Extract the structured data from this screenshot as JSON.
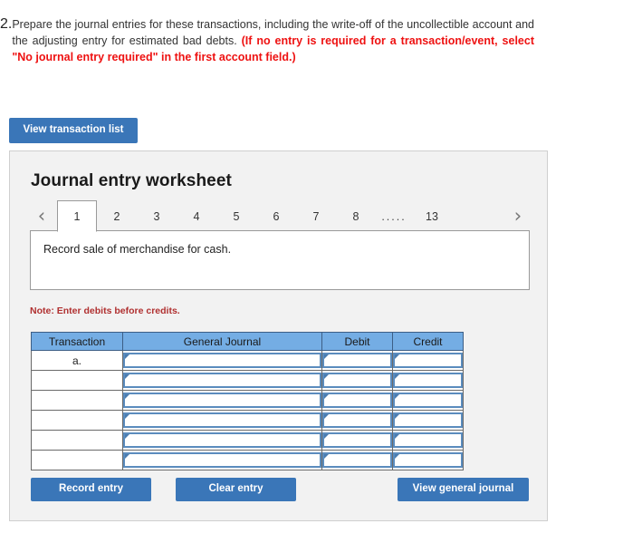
{
  "question": {
    "number": "2.",
    "text_plain_1": "Prepare the journal entries for these transactions, including the write-off of the uncollectible account and the adjusting entry for estimated bad debts. ",
    "text_red": "(If no entry is required for a transaction/event, select \"No journal entry required\" in the first account field.)"
  },
  "toolbar": {
    "view_transaction_list_label": "View transaction list"
  },
  "panel": {
    "title": "Journal entry worksheet",
    "note": "Note: Enter debits before credits.",
    "instruction": "Record sale of merchandise for cash."
  },
  "pager": {
    "prev_icon": "‹",
    "next_icon": "›",
    "items": [
      {
        "label": "1",
        "active": true
      },
      {
        "label": "2",
        "active": false
      },
      {
        "label": "3",
        "active": false
      },
      {
        "label": "4",
        "active": false
      },
      {
        "label": "5",
        "active": false
      },
      {
        "label": "6",
        "active": false
      },
      {
        "label": "7",
        "active": false
      },
      {
        "label": "8",
        "active": false
      },
      {
        "label": ".....",
        "active": false,
        "ellipsis": true
      },
      {
        "label": "13",
        "active": false
      }
    ]
  },
  "table": {
    "headers": [
      "Transaction",
      "General Journal",
      "Debit",
      "Credit"
    ],
    "rows": [
      {
        "transaction": "a.",
        "general_journal": "",
        "debit": "",
        "credit": ""
      },
      {
        "transaction": "",
        "general_journal": "",
        "debit": "",
        "credit": ""
      },
      {
        "transaction": "",
        "general_journal": "",
        "debit": "",
        "credit": ""
      },
      {
        "transaction": "",
        "general_journal": "",
        "debit": "",
        "credit": ""
      },
      {
        "transaction": "",
        "general_journal": "",
        "debit": "",
        "credit": ""
      },
      {
        "transaction": "",
        "general_journal": "",
        "debit": "",
        "credit": ""
      }
    ]
  },
  "footer": {
    "record_entry_label": "Record entry",
    "clear_entry_label": "Clear entry",
    "view_general_journal_label": "View general journal"
  },
  "colors": {
    "button_blue": "#3a76b8",
    "table_header_blue": "#74ade4",
    "panel_bg": "#f2f2f2",
    "red_text": "#ee1111",
    "note_red": "#b03030",
    "field_border_blue": "#5b8cbe"
  }
}
